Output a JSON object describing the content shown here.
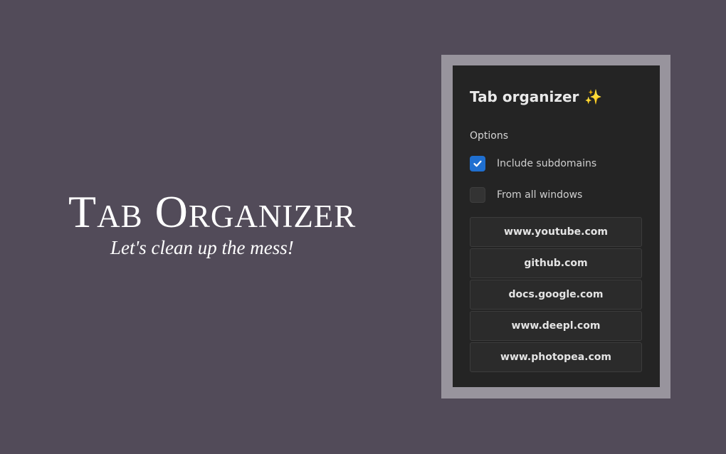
{
  "hero": {
    "title": "Tab Organizer",
    "subtitle": "Let's clean up the mess!"
  },
  "popup": {
    "title": "Tab organizer",
    "title_icon": "sparkles-icon",
    "options_label": "Options",
    "options": [
      {
        "label": "Include subdomains",
        "checked": true
      },
      {
        "label": "From all windows",
        "checked": false
      }
    ],
    "domains": [
      "www.youtube.com",
      "github.com",
      "docs.google.com",
      "www.deepl.com",
      "www.photopea.com"
    ]
  },
  "colors": {
    "background": "#524b59",
    "frame": "#98949d",
    "popup_background": "#242424",
    "checkbox_accent": "#1f6fd0",
    "sparkle": "#f5cf3c"
  }
}
